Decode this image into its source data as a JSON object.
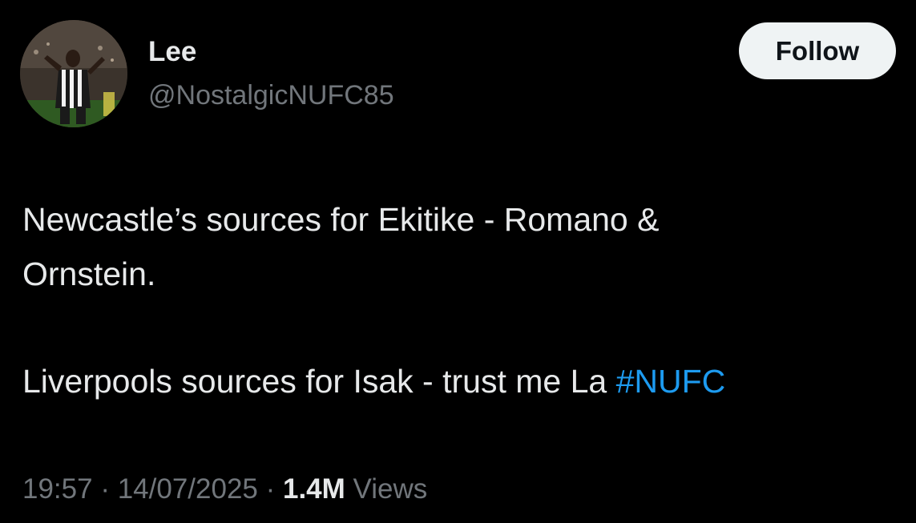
{
  "author": {
    "display_name": "Lee",
    "handle": "@NostalgicNUFC85"
  },
  "follow_button": {
    "label": "Follow"
  },
  "tweet": {
    "line1": "Newcastle’s sources for Ekitike - Romano &",
    "line2": "Ornstein.",
    "line3_text": "Liverpools sources for Isak - trust me La ",
    "hashtag": "#NUFC"
  },
  "meta": {
    "time": "19:57",
    "separator1": " · ",
    "date": "14/07/2025",
    "separator2": " · ",
    "views_count": "1.4M",
    "views_label": " Views"
  },
  "colors": {
    "background": "#000000",
    "text_primary": "#e7e9ea",
    "text_secondary": "#71767b",
    "link": "#1d9bf0",
    "follow_bg": "#eff3f4"
  }
}
